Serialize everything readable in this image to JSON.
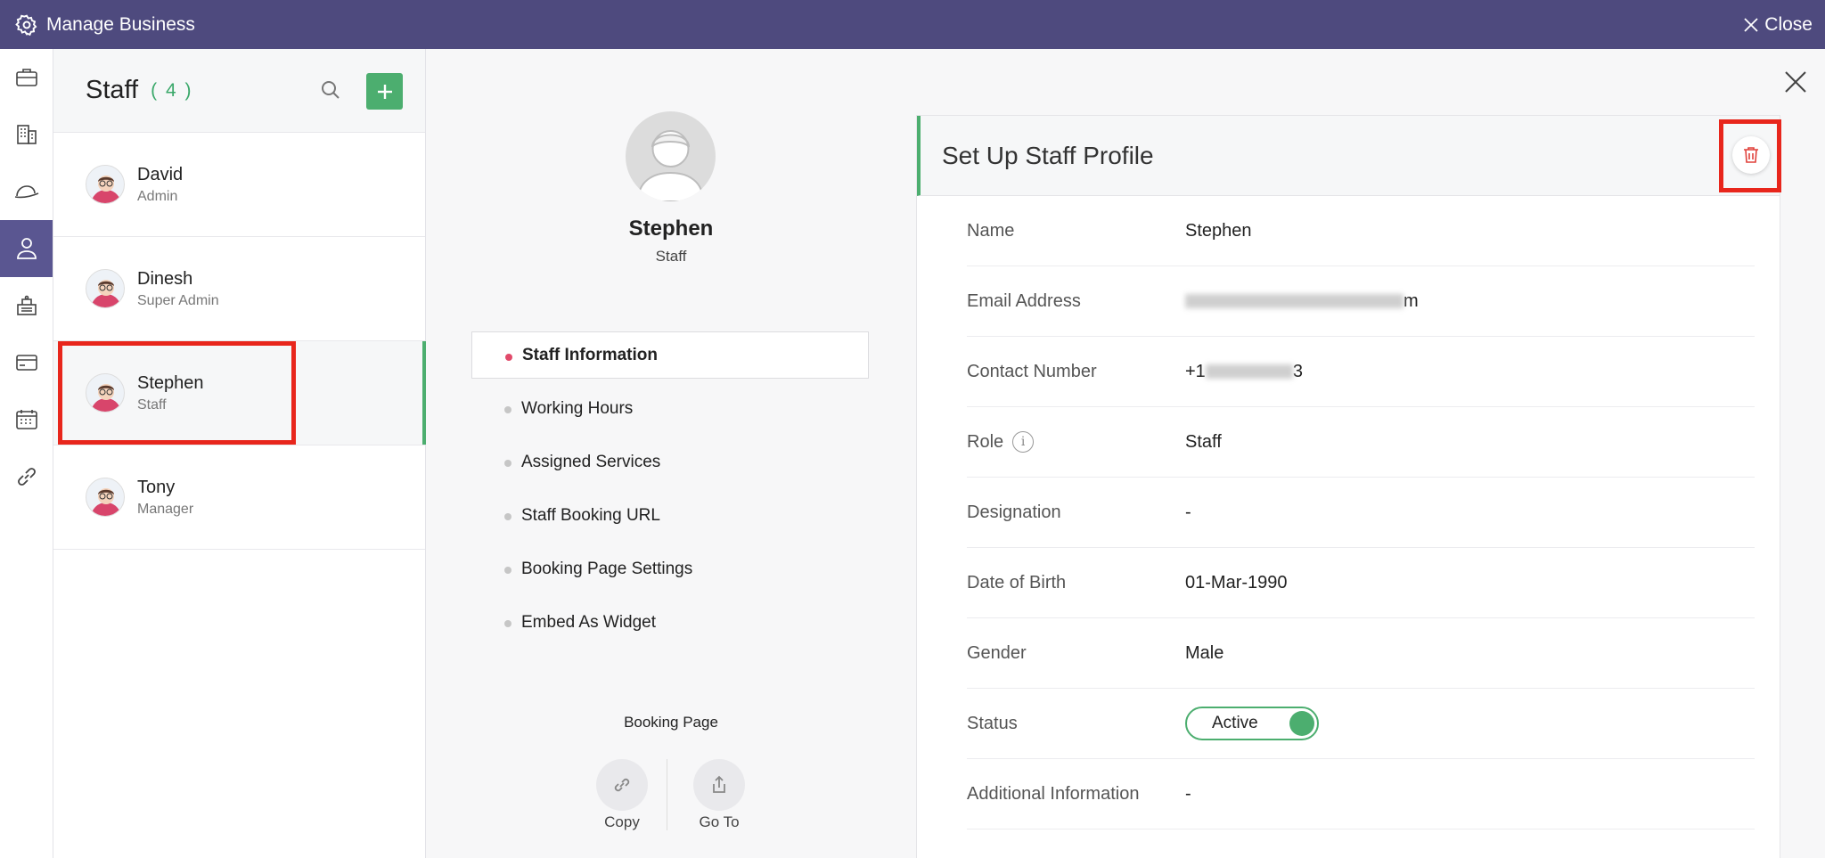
{
  "topbar": {
    "title": "Manage Business",
    "close_label": "Close"
  },
  "rail": {
    "icons": [
      "briefcase-icon",
      "building-icon",
      "cap-icon",
      "staff-icon",
      "desk-icon",
      "card-icon",
      "calendar-icon",
      "link-icon"
    ],
    "active_index": 3
  },
  "staff": {
    "title": "Staff",
    "count": "( 4 )",
    "members": [
      {
        "name": "David",
        "role": "Admin"
      },
      {
        "name": "Dinesh",
        "role": "Super Admin"
      },
      {
        "name": "Stephen",
        "role": "Staff"
      },
      {
        "name": "Tony",
        "role": "Manager"
      }
    ],
    "selected_index": 2
  },
  "profile": {
    "name": "Stephen",
    "role": "Staff",
    "menu": [
      "Staff Information",
      "Working Hours",
      "Assigned Services",
      "Staff Booking URL",
      "Booking Page Settings",
      "Embed As Widget"
    ],
    "active_menu_index": 0,
    "booking_page_label": "Booking Page",
    "copy_label": "Copy",
    "goto_label": "Go To"
  },
  "form": {
    "title": "Set Up Staff Profile",
    "fields": {
      "name": {
        "label": "Name",
        "value": "Stephen"
      },
      "email": {
        "label": "Email Address",
        "value": "m"
      },
      "contact": {
        "label": "Contact Number",
        "prefix": "+1",
        "suffix": "3"
      },
      "role": {
        "label": "Role",
        "value": "Staff"
      },
      "designation": {
        "label": "Designation",
        "value": "-"
      },
      "dob": {
        "label": "Date of Birth",
        "value": "01-Mar-1990"
      },
      "gender": {
        "label": "Gender",
        "value": "Male"
      },
      "status": {
        "label": "Status",
        "value": "Active"
      },
      "additional": {
        "label": "Additional Information",
        "value": "-"
      }
    }
  },
  "colors": {
    "topbar": "#4e4a7e",
    "accent_green": "#4cae6f",
    "highlight_red": "#e8261c"
  }
}
